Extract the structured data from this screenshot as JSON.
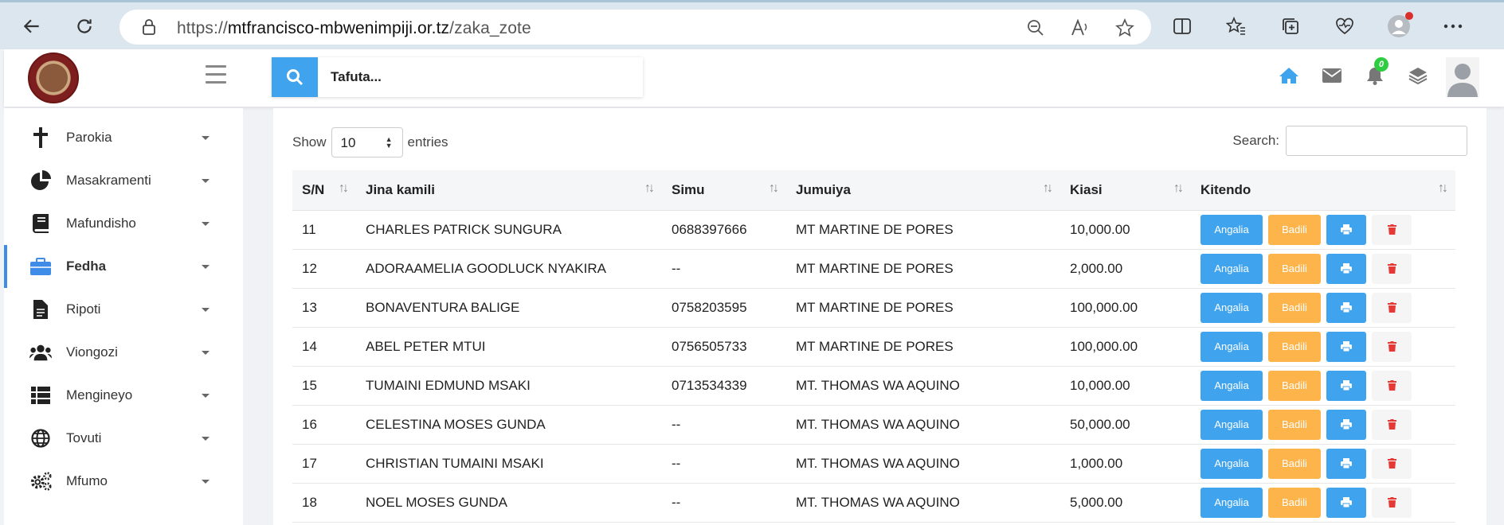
{
  "browser": {
    "url_prefix": "https://",
    "url_host": "mtfrancisco-mbwenimpiji.or.tz",
    "url_path": "/zaka_zote"
  },
  "header": {
    "search_placeholder": "Tafuta...",
    "notification_count": "0"
  },
  "sidebar": {
    "items": [
      {
        "label": "Parokia",
        "icon": "cross-icon"
      },
      {
        "label": "Masakramenti",
        "icon": "pie-chart-icon"
      },
      {
        "label": "Mafundisho",
        "icon": "book-icon"
      },
      {
        "label": "Fedha",
        "icon": "briefcase-icon",
        "active": true
      },
      {
        "label": "Ripoti",
        "icon": "file-icon"
      },
      {
        "label": "Viongozi",
        "icon": "users-icon"
      },
      {
        "label": "Mengineyo",
        "icon": "list-icon"
      },
      {
        "label": "Tovuti",
        "icon": "globe-icon"
      },
      {
        "label": "Mfumo",
        "icon": "cogs-icon"
      }
    ]
  },
  "table_controls": {
    "show_label": "Show",
    "entries_value": "10",
    "entries_label": "entries",
    "search_label": "Search:"
  },
  "table": {
    "columns": [
      "S/N",
      "Jina kamili",
      "Simu",
      "Jumuiya",
      "Kiasi",
      "Kitendo"
    ],
    "rows": [
      [
        "11",
        "CHARLES PATRICK SUNGURA",
        "0688397666",
        "MT MARTINE DE PORES",
        "10,000.00"
      ],
      [
        "12",
        "ADORAAMELIA GOODLUCK NYAKIRA",
        "--",
        "MT MARTINE DE PORES",
        "2,000.00"
      ],
      [
        "13",
        "BONAVENTURA BALIGE",
        "0758203595",
        "MT MARTINE DE PORES",
        "100,000.00"
      ],
      [
        "14",
        "ABEL PETER MTUI",
        "0756505733",
        "MT MARTINE DE PORES",
        "100,000.00"
      ],
      [
        "15",
        "TUMAINI EDMUND MSAKI",
        "0713534339",
        "MT. THOMAS WA AQUINO",
        "10,000.00"
      ],
      [
        "16",
        "CELESTINA MOSES GUNDA",
        "--",
        "MT. THOMAS WA AQUINO",
        "50,000.00"
      ],
      [
        "17",
        "CHRISTIAN TUMAINI MSAKI",
        "--",
        "MT. THOMAS WA AQUINO",
        "1,000.00"
      ],
      [
        "18",
        "NOEL MOSES GUNDA",
        "--",
        "MT. THOMAS WA AQUINO",
        "5,000.00"
      ]
    ],
    "view_label": "Angalia",
    "edit_label": "Badili"
  },
  "colors": {
    "primary": "#3fa3ee",
    "warning": "#fdb44b",
    "danger": "#e53935",
    "badge": "#2ecc40"
  }
}
